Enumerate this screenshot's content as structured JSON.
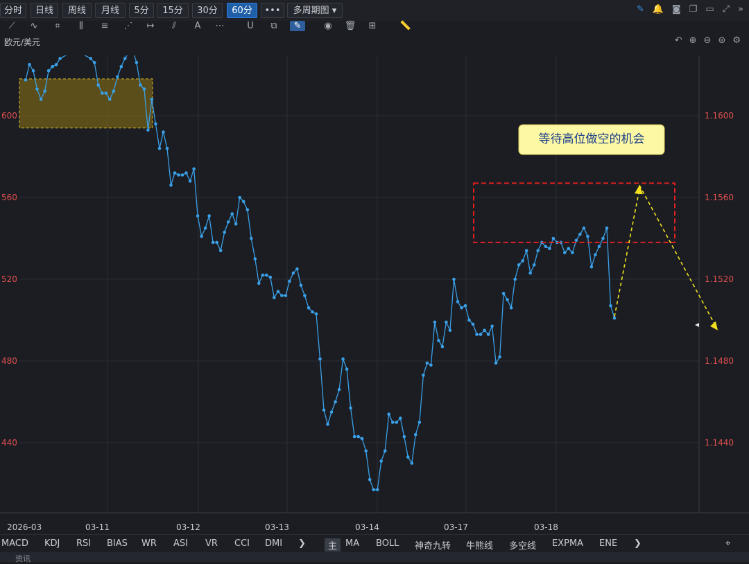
{
  "timeframes": [
    "分时",
    "日线",
    "周线",
    "月线",
    "5分",
    "15分",
    "30分",
    "60分"
  ],
  "active_timeframe": "60分",
  "more_label": "•••",
  "multi_period_label": "多周期图 ▾",
  "symbol": "欧元/美元",
  "indicators_left": [
    "MACD",
    "KDJ",
    "RSI",
    "BIAS",
    "WR",
    "ASI",
    "VR",
    "CCI",
    "DMI"
  ],
  "indicators_right": [
    "主",
    "MA",
    "BOLL",
    "神奇九转",
    "牛熊线",
    "多空线",
    "EXPMA",
    "ENE"
  ],
  "footer_text": "资讯",
  "chart_data": {
    "type": "line",
    "x_labels": [
      "2026-03",
      "03-11",
      "03-12",
      "03-13",
      "03-14",
      "03-17",
      "03-18"
    ],
    "y_ticks_right": [
      "1.1600",
      "1.1560",
      "1.1520",
      "1.1480",
      "1.1440"
    ],
    "y_ticks_left": [
      "600",
      "560",
      "520",
      "480",
      "440"
    ],
    "ylim": [
      1.1413,
      1.1629
    ],
    "series": [
      {
        "color": "#3aa0e8",
        "values": [
          1.16175,
          1.1625,
          1.1622,
          1.1613,
          1.1608,
          1.1612,
          1.1622,
          1.1624,
          1.1625,
          1.1628,
          1.1629,
          1.163,
          1.1631,
          1.1632,
          1.1631,
          1.163,
          1.1629,
          1.1628,
          1.1626,
          1.1615,
          1.1611,
          1.1611,
          1.1608,
          1.1612,
          1.1619,
          1.1624,
          1.1628,
          1.1631,
          1.1632,
          1.1626,
          1.1615,
          1.1613,
          1.1593,
          1.1608,
          1.1596,
          1.1584,
          1.1592,
          1.1584,
          1.1566,
          1.1572,
          1.1571,
          1.1571,
          1.1572,
          1.1568,
          1.1574,
          1.1551,
          1.1541,
          1.1545,
          1.1551,
          1.1538,
          1.1538,
          1.1534,
          1.1543,
          1.1548,
          1.1552,
          1.1547,
          1.156,
          1.1558,
          1.1554,
          1.154,
          1.153,
          1.1518,
          1.1522,
          1.1522,
          1.1521,
          1.1511,
          1.1514,
          1.1512,
          1.1512,
          1.1519,
          1.1523,
          1.1525,
          1.1517,
          1.1512,
          1.1506,
          1.1504,
          1.1503,
          1.1481,
          1.1456,
          1.1449,
          1.1455,
          1.146,
          1.1466,
          1.1481,
          1.1476,
          1.1457,
          1.1443,
          1.1443,
          1.1442,
          1.1436,
          1.1422,
          1.1417,
          1.1417,
          1.1431,
          1.1436,
          1.1454,
          1.145,
          1.145,
          1.1452,
          1.1443,
          1.1433,
          1.143,
          1.1444,
          1.145,
          1.1473,
          1.1479,
          1.1478,
          1.1499,
          1.149,
          1.1487,
          1.1499,
          1.1495,
          1.152,
          1.1509,
          1.1506,
          1.1507,
          1.15,
          1.1498,
          1.1493,
          1.1493,
          1.1495,
          1.1493,
          1.1497,
          1.1479,
          1.1482,
          1.1513,
          1.151,
          1.1506,
          1.152,
          1.1527,
          1.1529,
          1.1534,
          1.1523,
          1.1527,
          1.1534,
          1.1538,
          1.1536,
          1.1535,
          1.154,
          1.1538,
          1.1538,
          1.1533,
          1.1535,
          1.1533,
          1.1539,
          1.1542,
          1.1545,
          1.1541,
          1.1526,
          1.1532,
          1.1536,
          1.154,
          1.1545,
          1.1507,
          1.1501
        ]
      }
    ],
    "annotations": {
      "callout_text": "等待高位做空的机会",
      "highlight_box_yrange": [
        1.1594,
        1.1618
      ],
      "dashed_red_box_yrange": [
        1.1538,
        1.1567
      ],
      "arrow_peak": 1.1566,
      "arrow_target": 1.1495
    }
  }
}
